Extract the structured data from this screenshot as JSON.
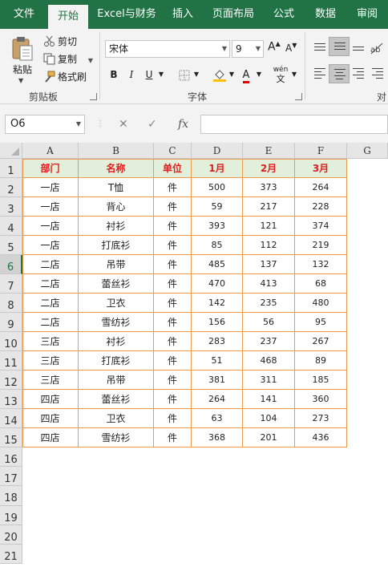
{
  "tabs": [
    "文件",
    "开始",
    "Excel与财务",
    "插入",
    "页面布局",
    "公式",
    "数据",
    "审阅"
  ],
  "active_tab": "开始",
  "clipboard": {
    "paste_label": "粘贴",
    "cut_label": "剪切",
    "copy_label": "复制",
    "format_painter_label": "格式刷",
    "group_label": "剪贴板"
  },
  "font": {
    "name": "宋体",
    "size": "9",
    "grow_glyph": "A",
    "shrink_glyph": "A",
    "bold": "B",
    "italic": "I",
    "underline": "U",
    "wen_glyph": "wén",
    "wen_char": "文",
    "font_color_glyph": "A",
    "group_label": "字体",
    "font_color": "#e00000",
    "fill_color": "#ffc000"
  },
  "alignment": {
    "group_label": "对"
  },
  "formula_bar": {
    "name_box": "O6",
    "cancel_glyph": "✕",
    "enter_glyph": "✓",
    "fx_glyph": "fx",
    "formula": ""
  },
  "sheet": {
    "columns": [
      "A",
      "B",
      "C",
      "D",
      "E",
      "F",
      "G"
    ],
    "row_numbers": [
      "1",
      "2",
      "3",
      "4",
      "5",
      "6",
      "7",
      "8",
      "9",
      "10",
      "11",
      "12",
      "13",
      "14",
      "15",
      "16",
      "17",
      "18",
      "19",
      "20",
      "21"
    ],
    "selected_row": "6",
    "headers": [
      "部门",
      "名称",
      "单位",
      "1月",
      "2月",
      "3月"
    ],
    "rows": [
      [
        "一店",
        "T恤",
        "件",
        "500",
        "373",
        "264"
      ],
      [
        "一店",
        "背心",
        "件",
        "59",
        "217",
        "228"
      ],
      [
        "一店",
        "衬衫",
        "件",
        "393",
        "121",
        "374"
      ],
      [
        "一店",
        "打底衫",
        "件",
        "85",
        "112",
        "219"
      ],
      [
        "二店",
        "吊带",
        "件",
        "485",
        "137",
        "132"
      ],
      [
        "二店",
        "蕾丝衫",
        "件",
        "470",
        "413",
        "68"
      ],
      [
        "二店",
        "卫衣",
        "件",
        "142",
        "235",
        "480"
      ],
      [
        "二店",
        "雪纺衫",
        "件",
        "156",
        "56",
        "95"
      ],
      [
        "三店",
        "衬衫",
        "件",
        "283",
        "237",
        "267"
      ],
      [
        "三店",
        "打底衫",
        "件",
        "51",
        "468",
        "89"
      ],
      [
        "三店",
        "吊带",
        "件",
        "381",
        "311",
        "185"
      ],
      [
        "四店",
        "蕾丝衫",
        "件",
        "264",
        "141",
        "360"
      ],
      [
        "四店",
        "卫衣",
        "件",
        "63",
        "104",
        "273"
      ],
      [
        "四店",
        "雪纺衫",
        "件",
        "368",
        "201",
        "436"
      ]
    ]
  },
  "colors": {
    "brand": "#217346",
    "header_fill": "#e2efda",
    "header_text": "#e02020",
    "table_border": "#ec9a4a"
  }
}
